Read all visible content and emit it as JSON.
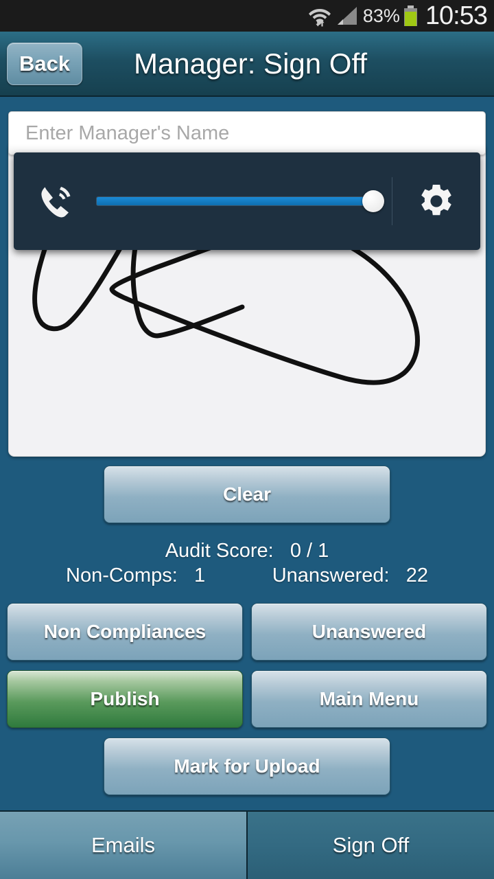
{
  "status_bar": {
    "wifi_icon": "wifi-icon",
    "signal_icon": "cellular-signal-icon",
    "battery_percent": "83%",
    "battery_icon": "battery-icon",
    "clock": "10:53"
  },
  "header": {
    "back_label": "Back",
    "title": "Manager: Sign Off"
  },
  "form": {
    "manager_name_placeholder": "Enter Manager's Name",
    "manager_name_value": ""
  },
  "signature": {
    "region_name": "signature-canvas",
    "clear_label": "Clear"
  },
  "volume_overlay": {
    "ringer_icon": "phone-ringer-icon",
    "settings_icon": "gear-icon",
    "slider_value": 100,
    "slider_min": 0,
    "slider_max": 100
  },
  "summary": {
    "audit_score_label": "Audit Score:",
    "audit_score_value": "0 / 1",
    "non_comps_label": "Non-Comps:",
    "non_comps_value": "1",
    "unanswered_label": "Unanswered:",
    "unanswered_value": "22"
  },
  "actions": {
    "non_compliances": "Non Compliances",
    "unanswered": "Unanswered",
    "publish": "Publish",
    "main_menu": "Main Menu",
    "mark_for_upload": "Mark for Upload"
  },
  "tabbar": {
    "emails": "Emails",
    "sign_off": "Sign Off"
  },
  "colors": {
    "page_background": "#1e5a7d",
    "header_top": "#2c6e86",
    "overlay_background": "#1e3040",
    "slider_blue": "#1278bf",
    "publish_green": "#2f7a3d",
    "battery_green": "#9fc814",
    "status_bar": "#1b1b1b"
  }
}
